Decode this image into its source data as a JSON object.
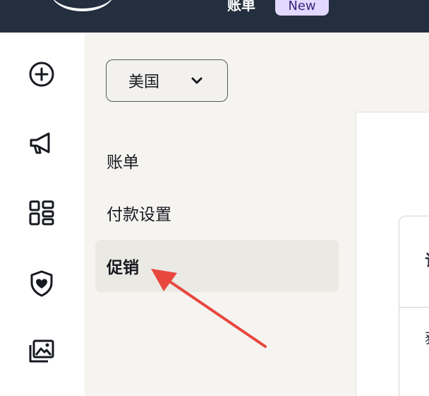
{
  "topbar": {
    "title": "账单",
    "badge": "New"
  },
  "rail": {
    "icons": [
      "plus-circle-icon",
      "megaphone-icon",
      "grid-icon",
      "shield-heart-icon",
      "image-icon"
    ]
  },
  "sidebar": {
    "region_select": "美国",
    "items": [
      {
        "label": "账单",
        "active": false
      },
      {
        "label": "付款设置",
        "active": false
      },
      {
        "label": "促销",
        "active": true
      }
    ]
  },
  "main": {
    "text_1": "订",
    "text_2": "获\n應"
  },
  "annotation": {
    "color": "#e8473e"
  }
}
